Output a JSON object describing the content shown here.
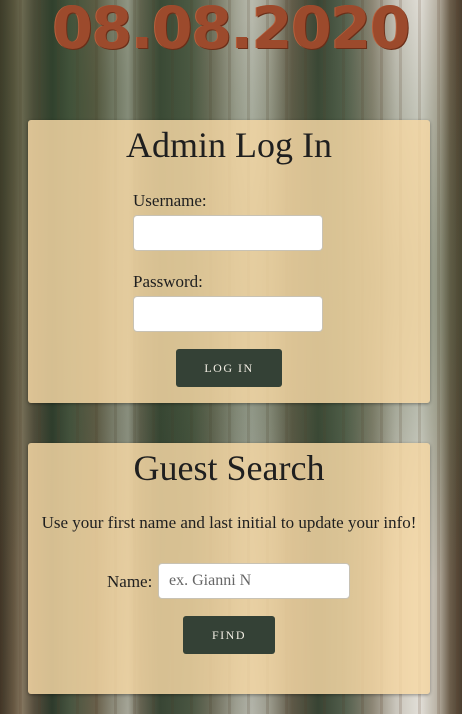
{
  "header": {
    "date": "08.08.2020"
  },
  "admin_login": {
    "title": "Admin Log In",
    "username_label": "Username:",
    "username_value": "",
    "password_label": "Password:",
    "password_value": "",
    "login_button": "LOG IN"
  },
  "guest_search": {
    "title": "Guest Search",
    "description": "Use your first name and last initial to update your info!",
    "name_label": "Name:",
    "name_placeholder": "ex. Gianni N",
    "name_value": "",
    "find_button": "FIND"
  },
  "colors": {
    "date_text": "#9c4a2c",
    "card_background": "#f5d8a5",
    "button_background": "#344136",
    "button_text": "#f1ede3"
  }
}
